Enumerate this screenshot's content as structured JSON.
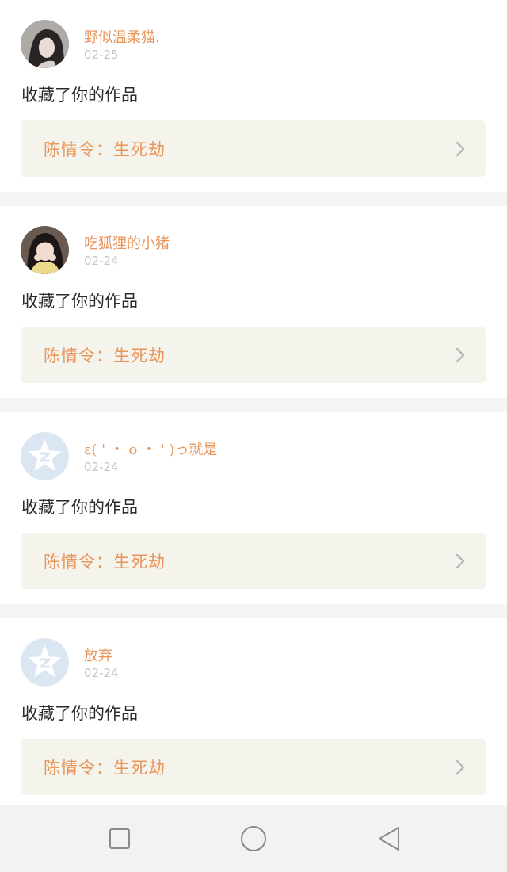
{
  "notifications": [
    {
      "username": "野似温柔猫.",
      "date": "02-25",
      "action": "收藏了你的作品",
      "work_title": "陈情令：生死劫",
      "avatar": "photo-girl-dark-hair"
    },
    {
      "username": "吃狐狸的小猪",
      "date": "02-24",
      "action": "收藏了你的作品",
      "work_title": "陈情令：生死劫",
      "avatar": "photo-girl-yellow-sweater"
    },
    {
      "username": "ε( ' ・ o ・ ' )っ就是",
      "date": "02-24",
      "action": "收藏了你的作品",
      "work_title": "陈情令：生死劫",
      "avatar": "default-star-avatar-icon"
    },
    {
      "username": "放弃",
      "date": "02-24",
      "action": "收藏了你的作品",
      "work_title": "陈情令：生死劫",
      "avatar": "default-star-avatar-icon"
    }
  ],
  "navbar": {
    "recent_icon": "square-icon",
    "home_icon": "circle-icon",
    "back_icon": "triangle-back-icon"
  },
  "colors": {
    "accent": "#e8955a",
    "date": "#c4c4c4",
    "work_bg": "#f4f3ec",
    "default_avatar": "#dbe6f3"
  }
}
